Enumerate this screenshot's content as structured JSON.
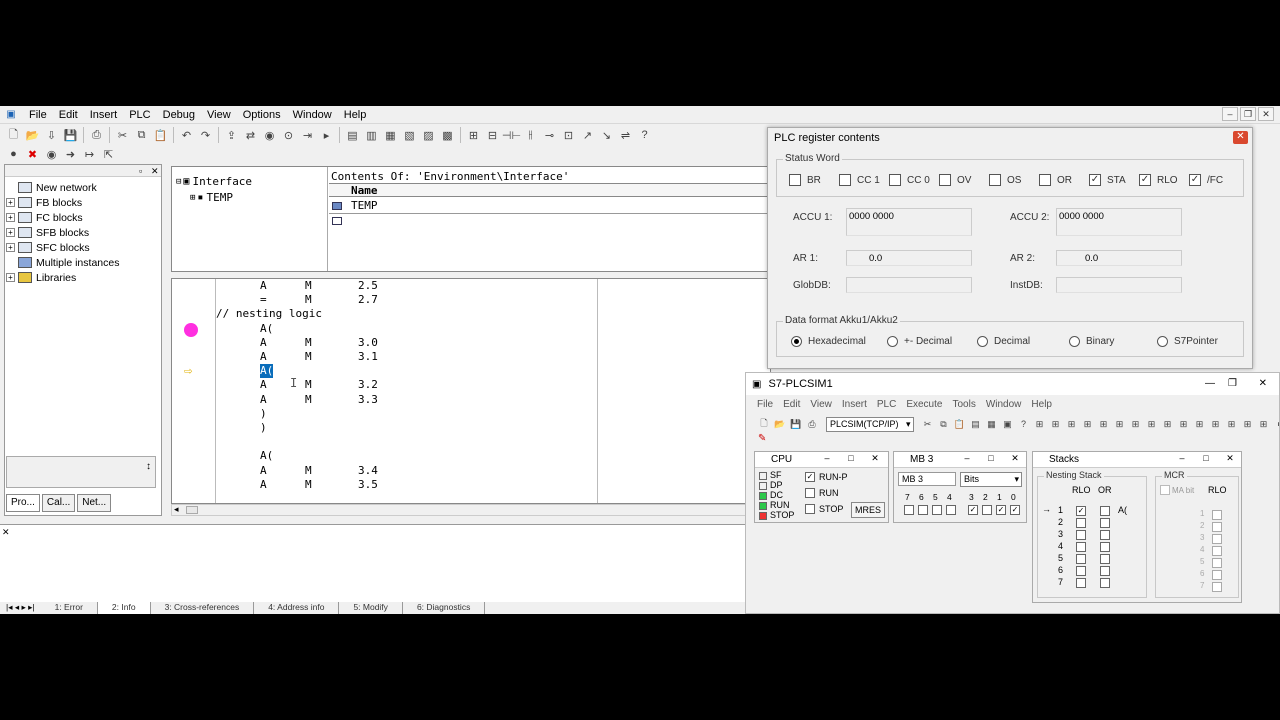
{
  "menubar": {
    "items": [
      "File",
      "Edit",
      "Insert",
      "PLC",
      "Debug",
      "View",
      "Options",
      "Window",
      "Help"
    ]
  },
  "catalog": {
    "items": [
      {
        "label": "New network",
        "expander": ""
      },
      {
        "label": "FB blocks",
        "expander": "+"
      },
      {
        "label": "FC blocks",
        "expander": "+"
      },
      {
        "label": "SFB blocks",
        "expander": "+"
      },
      {
        "label": "SFC blocks",
        "expander": "+"
      },
      {
        "label": "Multiple instances",
        "expander": ""
      },
      {
        "label": "Libraries",
        "expander": "+"
      }
    ],
    "tabs": [
      "Pro...",
      "Cal...",
      "Net..."
    ]
  },
  "interface": {
    "tree_root": "Interface",
    "tree_child": "TEMP",
    "contents_title": "Contents Of: 'Environment\\Interface'",
    "column_name": "Name",
    "row_value": "TEMP"
  },
  "editor": {
    "lines": [
      {
        "op": "A",
        "addr": "M",
        "bit": "2.5"
      },
      {
        "op": "=",
        "addr": "M",
        "bit": "2.7"
      },
      {
        "comment": "// nesting logic"
      },
      {
        "op": "A("
      },
      {
        "op": "A",
        "addr": "M",
        "bit": "3.0"
      },
      {
        "op": "A",
        "addr": "M",
        "bit": "3.1"
      },
      {
        "op": "A(",
        "highlight": true
      },
      {
        "op": "A",
        "addr": "M",
        "bit": "3.2"
      },
      {
        "op": "A",
        "addr": "M",
        "bit": "3.3"
      },
      {
        "op": ")"
      },
      {
        "op": ")"
      },
      {
        "op": ""
      },
      {
        "op": "A("
      },
      {
        "op": "A",
        "addr": "M",
        "bit": "3.4"
      },
      {
        "op": "A",
        "addr": "M",
        "bit": "3.5"
      }
    ],
    "breakpoint_color": "#ff2fe0",
    "highlight_color": "#0a6dbb"
  },
  "output_tabs": [
    "1: Error",
    "2: Info",
    "3: Cross-references",
    "4: Address info",
    "5: Modify",
    "6: Diagnostics"
  ],
  "plc_register": {
    "title": "PLC register contents",
    "status_word_label": "Status Word",
    "status_bits": [
      {
        "label": "BR",
        "checked": false
      },
      {
        "label": "CC 1",
        "checked": false
      },
      {
        "label": "CC 0",
        "checked": false
      },
      {
        "label": "OV",
        "checked": false
      },
      {
        "label": "OS",
        "checked": false
      },
      {
        "label": "OR",
        "checked": false
      },
      {
        "label": "STA",
        "checked": true
      },
      {
        "label": "RLO",
        "checked": true
      },
      {
        "label": "/FC",
        "checked": true
      }
    ],
    "accu1_label": "ACCU 1:",
    "accu1_value": "0000 0000",
    "accu2_label": "ACCU 2:",
    "accu2_value": "0000 0000",
    "ar1_label": "AR 1:",
    "ar1_value": "0.0",
    "ar2_label": "AR 2:",
    "ar2_value": "0.0",
    "globdb_label": "GlobDB:",
    "instdb_label": "InstDB:",
    "data_format_label": "Data format Akku1/Akku2",
    "formats": [
      {
        "label": "Hexadecimal",
        "selected": true
      },
      {
        "label": "+- Decimal",
        "selected": false
      },
      {
        "label": "Decimal",
        "selected": false
      },
      {
        "label": "Binary",
        "selected": false
      },
      {
        "label": "S7Pointer",
        "selected": false
      }
    ]
  },
  "plcsim": {
    "title": "S7-PLCSIM1",
    "menu": [
      "File",
      "Edit",
      "View",
      "Insert",
      "PLC",
      "Execute",
      "Tools",
      "Window",
      "Help"
    ],
    "connection": "PLCSIM(TCP/IP)",
    "cpu": {
      "title": "CPU",
      "leds": [
        "SF",
        "DP",
        "DC",
        "RUN",
        "STOP"
      ],
      "run_p": "RUN-P",
      "run": "RUN",
      "stop": "STOP",
      "mres": "MRES"
    },
    "mb": {
      "title": "MB  3",
      "address": "MB   3",
      "format": "Bits",
      "bits": [
        "7",
        "6",
        "5",
        "4",
        "3",
        "2",
        "1",
        "0"
      ]
    },
    "stacks": {
      "title": "Stacks",
      "nesting_label": "Nesting Stack",
      "rlo": "RLO",
      "or": "OR",
      "entry": "A(",
      "mcr_label": "MCR",
      "ma_label": "MA bit",
      "rows": [
        "1",
        "2",
        "3",
        "4",
        "5",
        "6",
        "7"
      ]
    }
  }
}
